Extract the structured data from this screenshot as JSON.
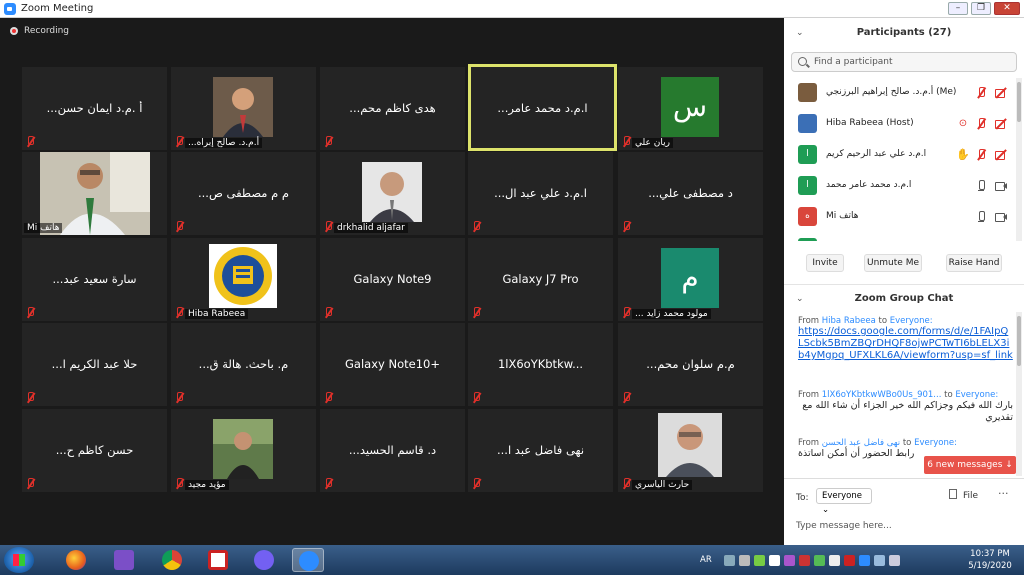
{
  "window": {
    "title": "Zoom Meeting"
  },
  "recording": {
    "label": "Recording"
  },
  "tiles": [
    {
      "name": "...أ .م.د ايمان حسن",
      "label": ""
    },
    {
      "name": "",
      "label": "...أ.م.د. صالح إبراه"
    },
    {
      "name": "...هدى كاظم محم",
      "label": ""
    },
    {
      "name": "...ا.م.د محمد عامر",
      "label": ""
    },
    {
      "name": "",
      "label": "ريان علي",
      "avatar": "س"
    },
    {
      "name": "",
      "label": "Mi هاتف"
    },
    {
      "name": "...م م مصطفى ص",
      "label": ""
    },
    {
      "name": "",
      "label": "drkhalid aljafar"
    },
    {
      "name": "...ا.م.د علي عبد ال",
      "label": ""
    },
    {
      "name": "...د مصطفى علي",
      "label": ""
    },
    {
      "name": "...سارة سعيد عبد",
      "label": ""
    },
    {
      "name": "",
      "label": "Hiba Rabeea"
    },
    {
      "name": "Galaxy Note9",
      "label": ""
    },
    {
      "name": "Galaxy J7 Pro",
      "label": ""
    },
    {
      "name": "",
      "label": "... مولود محمد زايد",
      "avatar": "م"
    },
    {
      "name": "...حلا عبد الكريم ا",
      "label": ""
    },
    {
      "name": "...م. باحث. هالة ق",
      "label": ""
    },
    {
      "name": "Galaxy Note10+",
      "label": ""
    },
    {
      "name": "1lX6oYKbtkw...",
      "label": ""
    },
    {
      "name": "...م.م سلوان محم",
      "label": ""
    },
    {
      "name": "...حسن كاظم ح",
      "label": ""
    },
    {
      "name": "",
      "label": "مؤيد مجيد"
    },
    {
      "name": "...د. قاسم الحسيد",
      "label": ""
    },
    {
      "name": "...نهى فاضل عبد ا",
      "label": ""
    },
    {
      "name": "",
      "label": "حارث الياسري"
    }
  ],
  "participants": {
    "title": "Participants (27)",
    "search_placeholder": "Find a participant",
    "list": [
      {
        "name": "أ.م.د. صالح إبراهيم البرزنجي (Me)",
        "avatar": "",
        "color": "#7a5c3e"
      },
      {
        "name": "Hiba Rabeea (Host)",
        "avatar": "",
        "color": "#3b6fb6"
      },
      {
        "name": "ا.م.د علي عبد الرحيم كريم",
        "avatar": "ا",
        "color": "#1f9d55"
      },
      {
        "name": "ا.م.د محمد عامر محمد",
        "avatar": "ا",
        "color": "#1f9d55"
      },
      {
        "name": "Mi هاتف",
        "avatar": "ه",
        "color": "#d9463b"
      }
    ],
    "buttons": {
      "invite": "Invite",
      "unmute_me": "Unmute Me",
      "raise_hand": "Raise Hand"
    }
  },
  "chat": {
    "title": "Zoom Group Chat",
    "messages": [
      {
        "from_prefix": "From",
        "sender": "Hiba Rabeea",
        "to_word": "to",
        "recipient": "Everyone:",
        "body": "https://docs.google.com/forms/d/e/1FAIpQLScbk5BmZBQrDHQF8ojwPCTwTI6bLELX3ib4yMgpq_UFXLKL6A/viewform?usp=sf_link"
      },
      {
        "from_prefix": "From",
        "sender": "1lX6oYKbtkwWBo0Us_901...",
        "to_word": "to",
        "recipient": "Everyone:",
        "body": "بارك الله فيكم وجزاكم الله خير الجزاء أن شاء الله مع تقديري"
      },
      {
        "from_prefix": "From",
        "sender": "نهى فاضل عبد الحسن",
        "to_word": "to",
        "recipient": "Everyone:",
        "body": "رابط الحضور أن أمكن اساتذة"
      }
    ],
    "new_messages": "6 new messages ↓",
    "to_label": "To:",
    "to_value": "Everyone ⌄",
    "file_label": "File",
    "more_label": "···",
    "input_placeholder": "Type message here..."
  },
  "taskbar": {
    "language": "AR",
    "time": "10:37 PM",
    "date": "5/19/2020"
  },
  "colors": {
    "active_speaker_border": "#dde36b",
    "mute_red": "#e0302a",
    "zoom_blue": "#2d8cff",
    "avatar_green_1": "#267a2e",
    "avatar_green_2": "#1a8a6e",
    "new_messages": "#e8534a"
  }
}
